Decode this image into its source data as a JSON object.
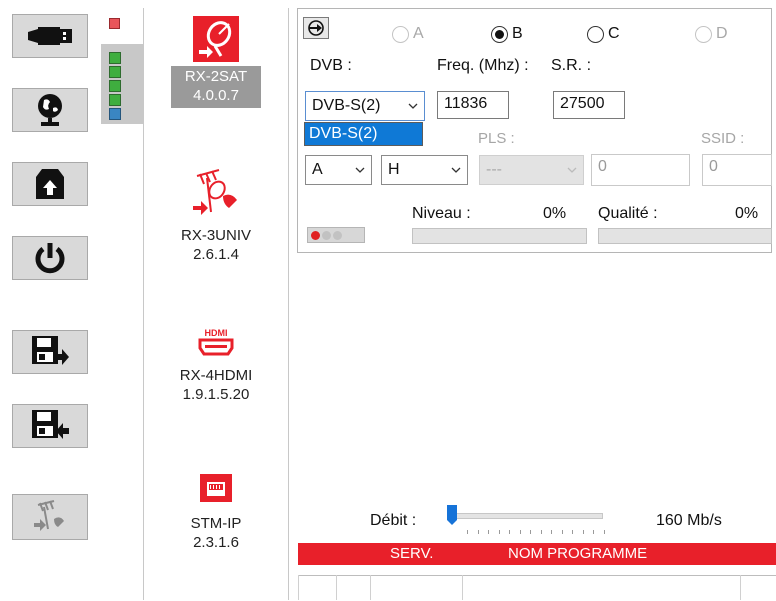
{
  "toolbar": {
    "buttons": [
      "usb-icon",
      "globe-icon",
      "firmware-box-icon",
      "power-icon",
      "save-export-icon",
      "load-import-icon",
      "antenna-config-icon"
    ]
  },
  "devices": [
    {
      "name": "RX-2SAT",
      "version": "4.0.0.7",
      "icon": "satellite-dish-icon",
      "selected": true
    },
    {
      "name": "RX-3UNIV",
      "version": "2.6.1.4",
      "icon": "antenna-cable-icon",
      "selected": false
    },
    {
      "name": "RX-4HDMI",
      "version": "1.9.1.5.20",
      "icon": "hdmi-icon",
      "selected": false
    },
    {
      "name": "STM-IP",
      "version": "2.3.1.6",
      "icon": "ethernet-port-icon",
      "selected": false
    }
  ],
  "tuner": {
    "inputs": [
      {
        "label": "A",
        "selected": false,
        "disabled": true
      },
      {
        "label": "B",
        "selected": true,
        "disabled": false
      },
      {
        "label": "C",
        "selected": false,
        "disabled": false
      },
      {
        "label": "D",
        "selected": false,
        "disabled": true
      }
    ],
    "dvb_label": "DVB :",
    "freq_label": "Freq. (Mhz) :",
    "sr_label": "S.R. :",
    "dvb_value": "DVB-S(2)",
    "dvb_option": "DVB-S(2)",
    "freq_value": "11836",
    "sr_value": "27500",
    "pls_label": "PLS :",
    "ssid_label": "SSID :",
    "polarity_a": "A",
    "polarity_h": "H",
    "pls_select": "---",
    "pls_value": "0",
    "ssid_value": "0",
    "niveau_label": "Niveau :",
    "niveau_value": "0%",
    "qualite_label": "Qualité :",
    "qualite_value": "0%",
    "niveau_fraction": 0,
    "qualite_fraction": 0
  },
  "debit": {
    "label": "Débit :",
    "value": "160 Mb/s"
  },
  "programme_table": {
    "columns": [
      "SERV.",
      "NOM PROGRAMME"
    ]
  },
  "colors": {
    "accent_red": "#e8202a",
    "selection_blue": "#0f79d6",
    "status_green": "#3fae3f"
  }
}
